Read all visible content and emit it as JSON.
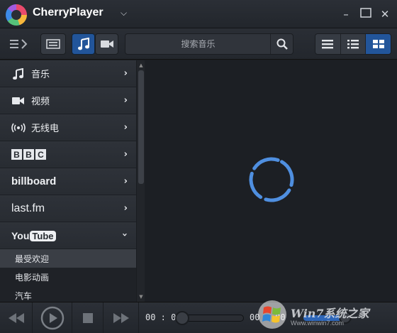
{
  "window": {
    "title": "CherryPlayer",
    "controls": {
      "minimize": "minimize-icon",
      "maximize": "maximize-icon",
      "close": "close-icon"
    }
  },
  "toolbar": {
    "search_placeholder": "搜索音乐",
    "active_media": "music",
    "active_view": "grid",
    "accent": "#22559a"
  },
  "sidebar": {
    "items": [
      {
        "label": "音乐",
        "icon": "music-note-icon"
      },
      {
        "label": "视频",
        "icon": "video-camera-icon"
      },
      {
        "label": "无线电",
        "icon": "radio-icon"
      },
      {
        "brand": "BBC",
        "letters": [
          "B",
          "B",
          "C"
        ]
      },
      {
        "brand": "billboard"
      },
      {
        "brand": "last.fm"
      },
      {
        "brand": "YouTube",
        "you": "You",
        "tube": "Tube",
        "expanded": true
      }
    ],
    "youtube_sub": [
      {
        "label": "最受欢迎",
        "selected": true
      },
      {
        "label": "电影动画",
        "selected": false
      },
      {
        "label": "汽车",
        "selected": false
      }
    ]
  },
  "player": {
    "elapsed": "00 : 00",
    "total": "00 : 00",
    "progress": 0,
    "volume_fraction": 0.85,
    "loading": true,
    "spinner_color": "#4f8fe0"
  },
  "watermark": {
    "text": "Win7系统之家",
    "url": "Www.winwin7.com"
  }
}
